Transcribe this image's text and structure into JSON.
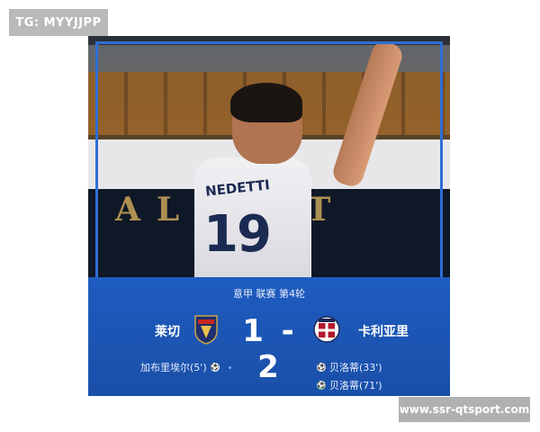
{
  "watermark_top": "TG: MYYJJPP",
  "watermark_bottom": "www.ssr-qtsport.com",
  "photo": {
    "ad_board_text": "AL OTT",
    "shirt_number": "19",
    "shirt_name": "NEDETTI"
  },
  "match": {
    "info": "意甲 联赛 第4轮",
    "home_team": "莱切",
    "away_team": "卡利亚里",
    "score": "1 - 2",
    "home_badge": "LECCE",
    "away_badge": "CAGLIARI",
    "home_scorers": [
      "加布里埃尔(5')"
    ],
    "away_scorers": [
      "贝洛蒂(33')",
      "贝洛蒂(71')"
    ]
  },
  "colors": {
    "panel_blue": "#1e5cc0",
    "frame_blue": "#2f6fd6",
    "home_badge_red": "#c8281f",
    "away_badge_red": "#b3162a"
  },
  "icons": [
    "ball-icon",
    "penalty-ball-icon",
    "lecce-badge",
    "cagliari-badge"
  ]
}
